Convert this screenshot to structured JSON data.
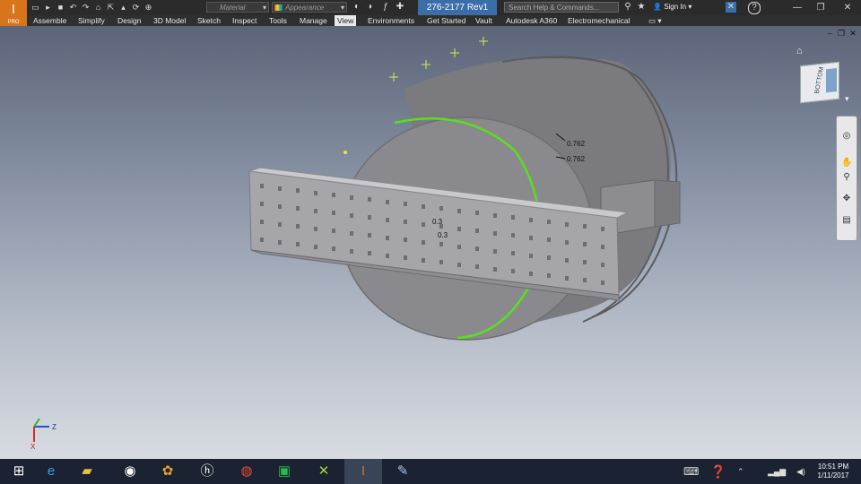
{
  "app": {
    "badge": "I",
    "badge_sub": "PRO"
  },
  "qat": {
    "icons": [
      "new-icon",
      "open-icon",
      "save-icon",
      "undo-icon",
      "redo-icon",
      "home-icon",
      "return-icon",
      "select-icon",
      "update-icon",
      "measure-icon"
    ]
  },
  "material_combo": "Material",
  "appearance_combo": "Appearance",
  "document_title": "276-2177 Rev1",
  "search": {
    "placeholder": "Search Help & Commands..."
  },
  "signin_label": "Sign In",
  "ribbon": {
    "tabs": [
      "Assemble",
      "Simplify",
      "Design",
      "3D Model",
      "Sketch",
      "Inspect",
      "Tools",
      "Manage",
      "View",
      "Environments",
      "Get Started",
      "Vault",
      "Autodesk A360",
      "Electromechanical"
    ],
    "active_tab": "View"
  },
  "viewcube": {
    "face_label": "BOTTOM"
  },
  "dimensions": {
    "top_a": "0.762",
    "top_b": "0.762",
    "mid_a": "0.3",
    "mid_b": "0.3"
  },
  "triad": {
    "z_label": "Z",
    "x_label": "X"
  },
  "taskbar": {
    "apps": [
      "windows-icon",
      "ie-icon",
      "file-explorer-icon",
      "camera-app-icon",
      "photos-app-icon",
      "hp-icon",
      "chrome-icon",
      "store-icon",
      "gamemaker-icon",
      "inventor-icon",
      "paint-icon"
    ],
    "active_app": "inventor-icon",
    "time": "10:51 PM",
    "date": "1/11/2017"
  },
  "colors": {
    "accent": "#3b6ea8",
    "inventor_orange": "#d8741c",
    "edge_highlight": "#5ae01c"
  }
}
